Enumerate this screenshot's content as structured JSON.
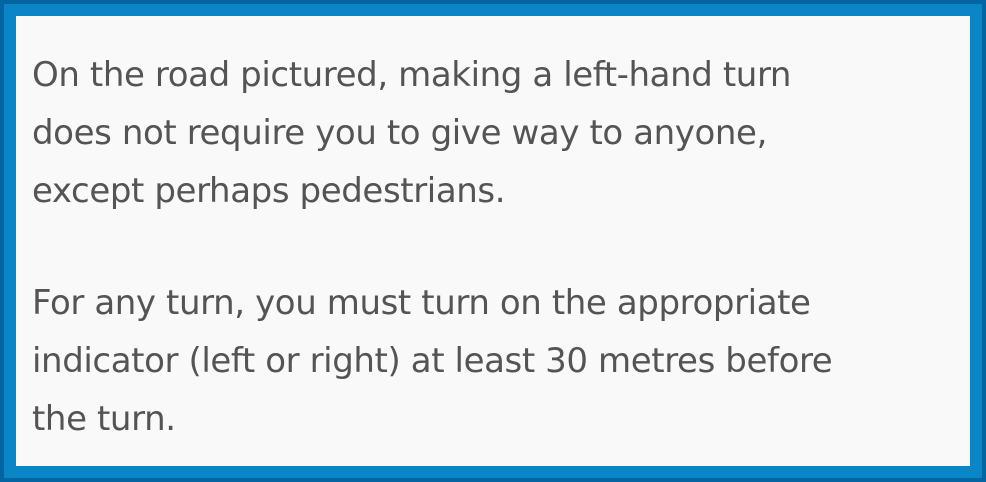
{
  "content": {
    "paragraph1": "On the road pictured, making a left-hand turn\ndoes not require you to give way to anyone,\nexcept perhaps pedestrians.",
    "paragraph2": "For any turn, you must turn on the appropriate\nindicator (left or right) at least 30 metres before\nthe turn."
  },
  "colors": {
    "frame": "#0a86c6",
    "frame_edge": "#0565a3",
    "panel_background": "#f9f9f9",
    "text": "#545454"
  }
}
